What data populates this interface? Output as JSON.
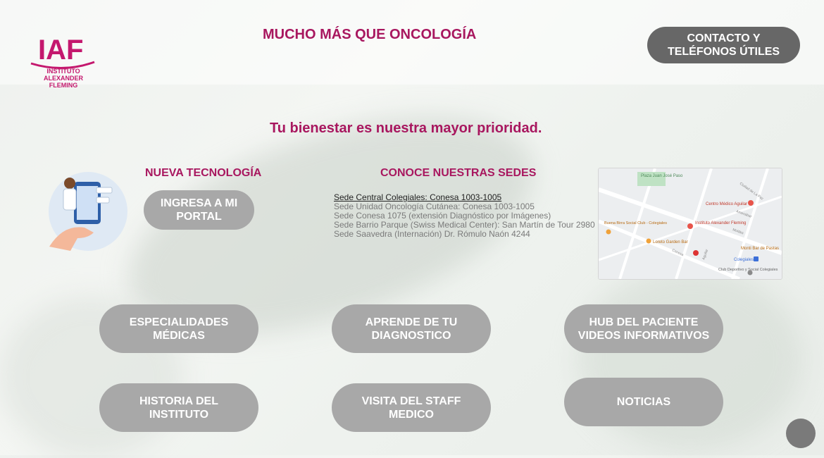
{
  "header": {
    "logo": {
      "initials": "IAF",
      "name_lines": [
        "INSTITUTO",
        "ALEXANDER",
        "FLEMING"
      ]
    },
    "headline": "MUCHO MÁS QUE ONCOLOGÍA",
    "contact_button": {
      "line1": "CONTACTO Y",
      "line2": "TELÉFONOS ÚTILES"
    }
  },
  "tagline": "Tu bienestar es nuestra mayor prioridad.",
  "nueva_tecnologia": {
    "title": "NUEVA TECNOLOGÍA",
    "portal_button": {
      "line1": "INGRESA A MI",
      "line2": "PORTAL"
    }
  },
  "sedes": {
    "title": "CONOCE NUESTRAS SEDES",
    "items": [
      "Sede Central Colegiales: Conesa 1003-1005",
      "Sede Unidad Oncología Cutánea: Conesa 1003-1005",
      "Sede Conesa 1075 (extensión Diagnóstico por Imágenes)",
      "Sede Barrio Parque (Swiss Medical Center): San Martín de Tour 2980",
      "Sede Saavedra (Internación) Dr. Rómulo Naón 4244"
    ],
    "map_labels": [
      "Plaza Juan José Paso",
      "Centro Médico Aguilar",
      "Instituto Alexander Fleming",
      "Buena Birra Social Club - Colegiales",
      "Loreto Garden Bar",
      "Monti Bar de Pastas",
      "Colegiales",
      "Club Deportivo y Social Colegiales",
      "Ciudad de La Paz",
      "Amenábar",
      "Moldes",
      "Conesa",
      "Aguilar"
    ]
  },
  "buttons": {
    "especialidades": {
      "line1": "ESPECIALIDADES",
      "line2": "MÉDICAS"
    },
    "aprende": {
      "line1": "APRENDE DE TU",
      "line2": "DIAGNOSTICO"
    },
    "hub": {
      "line1": "HUB DEL PACIENTE",
      "line2": "VIDEOS INFORMATIVOS"
    },
    "historia": {
      "line1": "HISTORIA DEL",
      "line2": "INSTITUTO"
    },
    "visita": {
      "line1": "VISITA DEL STAFF",
      "line2": "MEDICO"
    },
    "noticias": {
      "line1": "NOTICIAS"
    }
  },
  "colors": {
    "accent": "#a8175f",
    "button_gray": "#a8a8a8",
    "button_dark": "#676767"
  }
}
